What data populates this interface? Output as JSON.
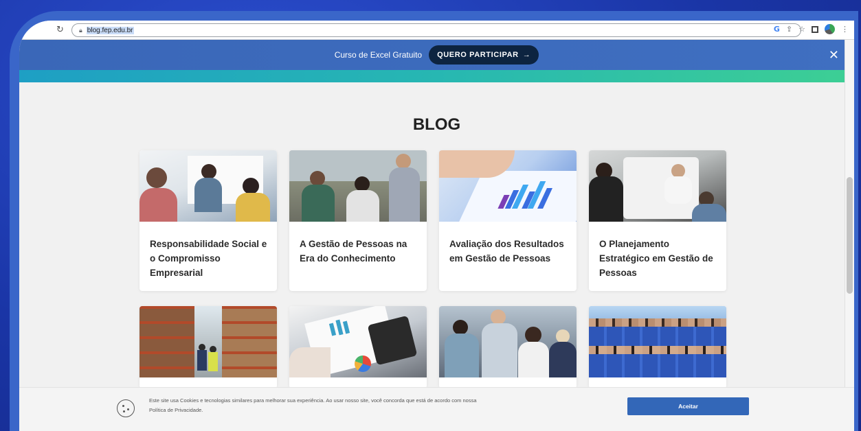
{
  "browser": {
    "url": "blog.fep.edu.br"
  },
  "promo": {
    "text": "Curso de Excel Gratuito",
    "cta_label": "QUERO PARTICIPAR",
    "cta_arrow": "→",
    "close_symbol": "✕"
  },
  "blog": {
    "title": "BLOG",
    "cards": [
      {
        "title": "Responsabilidade Social e o Compromisso Empresarial",
        "icon": "meeting-photo"
      },
      {
        "title": "A Gestão de Pessoas na Era do Conhecimento",
        "icon": "office-team-photo"
      },
      {
        "title": "Avaliação dos Resultados em Gestão de Pessoas",
        "icon": "chart-tablet-photo"
      },
      {
        "title": "O Planejamento Estratégico em Gestão de Pessoas",
        "icon": "team-table-photo"
      },
      {
        "title": "",
        "icon": "warehouse-photo"
      },
      {
        "title": "",
        "icon": "calculator-photo"
      },
      {
        "title": "",
        "icon": "office-discussion-photo"
      },
      {
        "title": "",
        "icon": "group-photo"
      }
    ]
  },
  "cookie": {
    "text": "Este site usa Cookies e tecnologias similares para melhorar sua experiência. Ao usar nosso site, você concorda que está de acordo com nossa Política de Privacidade.",
    "accept_label": "Aceitar"
  },
  "colors": {
    "background": "#1f3bb0",
    "frame": "#3a66c9",
    "promo": "#3f6fc1",
    "promo_button": "#0d2440",
    "accent_button": "#3367b8"
  }
}
